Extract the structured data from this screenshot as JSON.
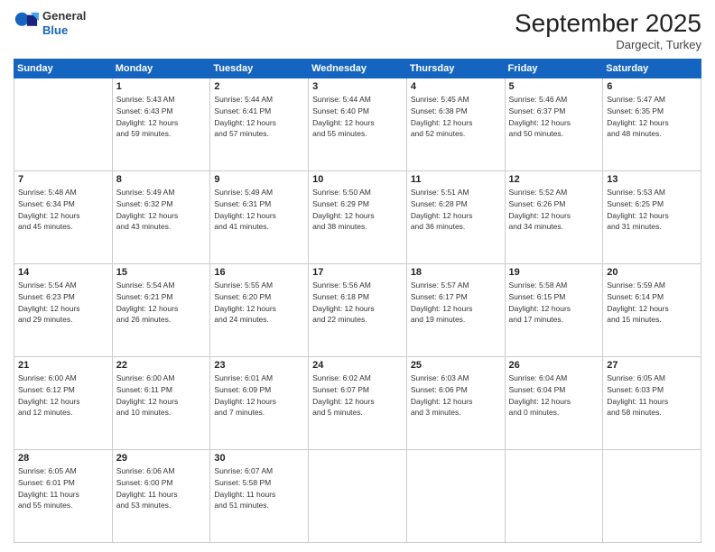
{
  "header": {
    "logo": {
      "general": "General",
      "blue": "Blue"
    },
    "title": "September 2025",
    "location": "Dargecit, Turkey"
  },
  "days_of_week": [
    "Sunday",
    "Monday",
    "Tuesday",
    "Wednesday",
    "Thursday",
    "Friday",
    "Saturday"
  ],
  "weeks": [
    [
      {
        "day": "",
        "info": ""
      },
      {
        "day": "1",
        "info": "Sunrise: 5:43 AM\nSunset: 6:43 PM\nDaylight: 12 hours\nand 59 minutes."
      },
      {
        "day": "2",
        "info": "Sunrise: 5:44 AM\nSunset: 6:41 PM\nDaylight: 12 hours\nand 57 minutes."
      },
      {
        "day": "3",
        "info": "Sunrise: 5:44 AM\nSunset: 6:40 PM\nDaylight: 12 hours\nand 55 minutes."
      },
      {
        "day": "4",
        "info": "Sunrise: 5:45 AM\nSunset: 6:38 PM\nDaylight: 12 hours\nand 52 minutes."
      },
      {
        "day": "5",
        "info": "Sunrise: 5:46 AM\nSunset: 6:37 PM\nDaylight: 12 hours\nand 50 minutes."
      },
      {
        "day": "6",
        "info": "Sunrise: 5:47 AM\nSunset: 6:35 PM\nDaylight: 12 hours\nand 48 minutes."
      }
    ],
    [
      {
        "day": "7",
        "info": "Sunrise: 5:48 AM\nSunset: 6:34 PM\nDaylight: 12 hours\nand 45 minutes."
      },
      {
        "day": "8",
        "info": "Sunrise: 5:49 AM\nSunset: 6:32 PM\nDaylight: 12 hours\nand 43 minutes."
      },
      {
        "day": "9",
        "info": "Sunrise: 5:49 AM\nSunset: 6:31 PM\nDaylight: 12 hours\nand 41 minutes."
      },
      {
        "day": "10",
        "info": "Sunrise: 5:50 AM\nSunset: 6:29 PM\nDaylight: 12 hours\nand 38 minutes."
      },
      {
        "day": "11",
        "info": "Sunrise: 5:51 AM\nSunset: 6:28 PM\nDaylight: 12 hours\nand 36 minutes."
      },
      {
        "day": "12",
        "info": "Sunrise: 5:52 AM\nSunset: 6:26 PM\nDaylight: 12 hours\nand 34 minutes."
      },
      {
        "day": "13",
        "info": "Sunrise: 5:53 AM\nSunset: 6:25 PM\nDaylight: 12 hours\nand 31 minutes."
      }
    ],
    [
      {
        "day": "14",
        "info": "Sunrise: 5:54 AM\nSunset: 6:23 PM\nDaylight: 12 hours\nand 29 minutes."
      },
      {
        "day": "15",
        "info": "Sunrise: 5:54 AM\nSunset: 6:21 PM\nDaylight: 12 hours\nand 26 minutes."
      },
      {
        "day": "16",
        "info": "Sunrise: 5:55 AM\nSunset: 6:20 PM\nDaylight: 12 hours\nand 24 minutes."
      },
      {
        "day": "17",
        "info": "Sunrise: 5:56 AM\nSunset: 6:18 PM\nDaylight: 12 hours\nand 22 minutes."
      },
      {
        "day": "18",
        "info": "Sunrise: 5:57 AM\nSunset: 6:17 PM\nDaylight: 12 hours\nand 19 minutes."
      },
      {
        "day": "19",
        "info": "Sunrise: 5:58 AM\nSunset: 6:15 PM\nDaylight: 12 hours\nand 17 minutes."
      },
      {
        "day": "20",
        "info": "Sunrise: 5:59 AM\nSunset: 6:14 PM\nDaylight: 12 hours\nand 15 minutes."
      }
    ],
    [
      {
        "day": "21",
        "info": "Sunrise: 6:00 AM\nSunset: 6:12 PM\nDaylight: 12 hours\nand 12 minutes."
      },
      {
        "day": "22",
        "info": "Sunrise: 6:00 AM\nSunset: 6:11 PM\nDaylight: 12 hours\nand 10 minutes."
      },
      {
        "day": "23",
        "info": "Sunrise: 6:01 AM\nSunset: 6:09 PM\nDaylight: 12 hours\nand 7 minutes."
      },
      {
        "day": "24",
        "info": "Sunrise: 6:02 AM\nSunset: 6:07 PM\nDaylight: 12 hours\nand 5 minutes."
      },
      {
        "day": "25",
        "info": "Sunrise: 6:03 AM\nSunset: 6:06 PM\nDaylight: 12 hours\nand 3 minutes."
      },
      {
        "day": "26",
        "info": "Sunrise: 6:04 AM\nSunset: 6:04 PM\nDaylight: 12 hours\nand 0 minutes."
      },
      {
        "day": "27",
        "info": "Sunrise: 6:05 AM\nSunset: 6:03 PM\nDaylight: 11 hours\nand 58 minutes."
      }
    ],
    [
      {
        "day": "28",
        "info": "Sunrise: 6:05 AM\nSunset: 6:01 PM\nDaylight: 11 hours\nand 55 minutes."
      },
      {
        "day": "29",
        "info": "Sunrise: 6:06 AM\nSunset: 6:00 PM\nDaylight: 11 hours\nand 53 minutes."
      },
      {
        "day": "30",
        "info": "Sunrise: 6:07 AM\nSunset: 5:58 PM\nDaylight: 11 hours\nand 51 minutes."
      },
      {
        "day": "",
        "info": ""
      },
      {
        "day": "",
        "info": ""
      },
      {
        "day": "",
        "info": ""
      },
      {
        "day": "",
        "info": ""
      }
    ]
  ]
}
